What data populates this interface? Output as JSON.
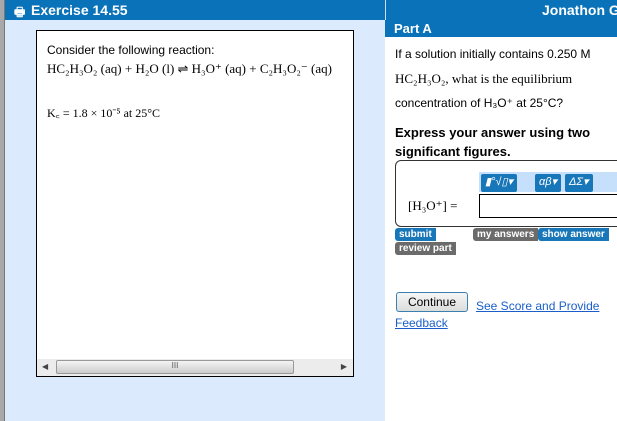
{
  "header": {
    "title": "Exercise 14.55",
    "user": "Jonathon G",
    "print_icon": "printer-icon"
  },
  "problem": {
    "intro": "Consider the following reaction:",
    "equation": "HC₂H₃O₂ (aq) + H₂O (l) ⇌ H₃O⁺ (aq) + C₂H₃O₂⁻ (aq)",
    "kc": "K꜀ = 1.8 × 10⁻⁵ at 25°C"
  },
  "part": {
    "label": "Part A",
    "question_lines": [
      "If a solution initially contains 0.250 M",
      "HC₂H₃O₂, what is the equilibrium",
      "concentration of H₃O⁺ at 25°C?"
    ],
    "instruction": "Express your answer using two significant figures.",
    "toolbar": [
      "▮°√▯▾",
      "αβ▾",
      "ΔΣ▾"
    ],
    "answer_label": "[H₃O⁺]  =",
    "answer_value": "",
    "buttons": {
      "submit": "submit",
      "my_answers": "my answers",
      "show_answer": "show answer",
      "review_part": "review part"
    },
    "continue": "Continue",
    "feedback_link": "See Score and Provide Feedback"
  },
  "scrollbar": {
    "grip": "III",
    "left": "◀",
    "right": "▶"
  }
}
